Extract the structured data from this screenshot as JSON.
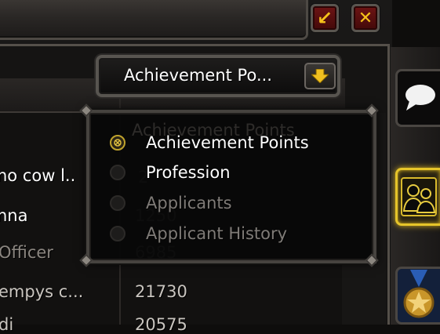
{
  "title_buttons": {
    "minimize_glyph": "↙",
    "close_glyph": "✕"
  },
  "dropdown": {
    "selected_label": "Achievement Po...",
    "arrow_icon": "arrow-down-icon"
  },
  "table": {
    "header_ghost": "Achievement Points",
    "rows": [
      {
        "name": "no cow l..",
        "value": "2"
      },
      {
        "name": "nna",
        "value": "1250"
      },
      {
        "name": "Officer",
        "value": "6985"
      },
      {
        "name": "empys c...",
        "value": "21730"
      },
      {
        "name": "di",
        "value": "20575"
      }
    ]
  },
  "menu": {
    "items": [
      {
        "label": "Achievement Points",
        "checked": true,
        "enabled": true
      },
      {
        "label": "Profession",
        "checked": false,
        "enabled": true
      },
      {
        "label": "Applicants",
        "checked": false,
        "enabled": false
      },
      {
        "label": "Applicant History",
        "checked": false,
        "enabled": false
      }
    ]
  },
  "side_tabs": [
    {
      "icon": "chat-bubble-icon"
    },
    {
      "icon": "guild-members-icon"
    },
    {
      "icon": "achievement-medal-icon"
    }
  ],
  "colors": {
    "accent_gold": "#f6c21a",
    "close_red": "#6d1414"
  }
}
